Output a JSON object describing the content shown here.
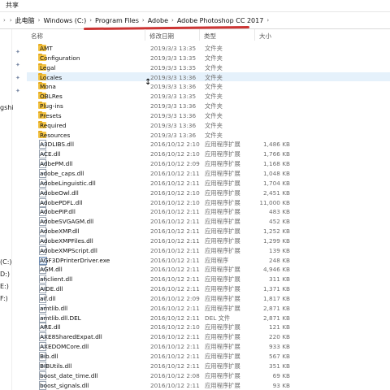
{
  "tab": {
    "label": "共享"
  },
  "address": {
    "crumbs": [
      "此电脑",
      "Windows (C:)",
      "Program Files",
      "Adobe",
      "Adobe Photoshop CC 2017"
    ],
    "chevron": "›"
  },
  "nav": {
    "fragments": [
      {
        "text": "gshi"
      },
      {
        "text": "(C:)"
      },
      {
        "text": "D:)"
      },
      {
        "text": "E:)"
      },
      {
        "text": "F:)"
      }
    ]
  },
  "columns": {
    "name": "名称",
    "date": "修改日期",
    "type": "类型",
    "size": "大小"
  },
  "files": [
    {
      "name": "AMT",
      "date": "2019/3/3 13:35",
      "type": "文件夹",
      "size": "",
      "kind": "folder"
    },
    {
      "name": "Configuration",
      "date": "2019/3/3 13:35",
      "type": "文件夹",
      "size": "",
      "kind": "folder"
    },
    {
      "name": "Legal",
      "date": "2019/3/3 13:35",
      "type": "文件夹",
      "size": "",
      "kind": "folder"
    },
    {
      "name": "Locales",
      "date": "2019/3/3 13:36",
      "type": "文件夹",
      "size": "",
      "kind": "folder",
      "selected": true
    },
    {
      "name": "Mona",
      "date": "2019/3/3 13:36",
      "type": "文件夹",
      "size": "",
      "kind": "folder"
    },
    {
      "name": "OBLRes",
      "date": "2019/3/3 13:35",
      "type": "文件夹",
      "size": "",
      "kind": "folder"
    },
    {
      "name": "Plug-ins",
      "date": "2019/3/3 13:36",
      "type": "文件夹",
      "size": "",
      "kind": "folder"
    },
    {
      "name": "Presets",
      "date": "2019/3/3 13:36",
      "type": "文件夹",
      "size": "",
      "kind": "folder"
    },
    {
      "name": "Required",
      "date": "2019/3/3 13:36",
      "type": "文件夹",
      "size": "",
      "kind": "folder"
    },
    {
      "name": "Resources",
      "date": "2019/3/3 13:36",
      "type": "文件夹",
      "size": "",
      "kind": "folder"
    },
    {
      "name": "A3DLIBS.dll",
      "date": "2016/10/12 2:10",
      "type": "应用程序扩展",
      "size": "1,486 KB",
      "kind": "dll"
    },
    {
      "name": "ACE.dll",
      "date": "2016/10/12 2:10",
      "type": "应用程序扩展",
      "size": "1,766 KB",
      "kind": "dll"
    },
    {
      "name": "AdbePM.dll",
      "date": "2016/10/12 2:09",
      "type": "应用程序扩展",
      "size": "1,168 KB",
      "kind": "dll"
    },
    {
      "name": "adobe_caps.dll",
      "date": "2016/10/12 2:11",
      "type": "应用程序扩展",
      "size": "1,048 KB",
      "kind": "dll"
    },
    {
      "name": "AdobeLinguistic.dll",
      "date": "2016/10/12 2:11",
      "type": "应用程序扩展",
      "size": "1,704 KB",
      "kind": "dll"
    },
    {
      "name": "AdobeOwl.dll",
      "date": "2016/10/12 2:10",
      "type": "应用程序扩展",
      "size": "2,451 KB",
      "kind": "dll"
    },
    {
      "name": "AdobePDFL.dll",
      "date": "2016/10/12 2:10",
      "type": "应用程序扩展",
      "size": "11,000 KB",
      "kind": "dll"
    },
    {
      "name": "AdobePIP.dll",
      "date": "2016/10/12 2:11",
      "type": "应用程序扩展",
      "size": "483 KB",
      "kind": "dll"
    },
    {
      "name": "AdobeSVGAGM.dll",
      "date": "2016/10/12 2:11",
      "type": "应用程序扩展",
      "size": "452 KB",
      "kind": "dll"
    },
    {
      "name": "AdobeXMP.dll",
      "date": "2016/10/12 2:11",
      "type": "应用程序扩展",
      "size": "1,252 KB",
      "kind": "dll"
    },
    {
      "name": "AdobeXMPFiles.dll",
      "date": "2016/10/12 2:11",
      "type": "应用程序扩展",
      "size": "1,299 KB",
      "kind": "dll"
    },
    {
      "name": "AdobeXMPScript.dll",
      "date": "2016/10/12 2:11",
      "type": "应用程序扩展",
      "size": "139 KB",
      "kind": "dll"
    },
    {
      "name": "AGF3DPrinterDriver.exe",
      "date": "2016/10/12 2:11",
      "type": "应用程序",
      "size": "248 KB",
      "kind": "exe"
    },
    {
      "name": "AGM.dll",
      "date": "2016/10/12 2:11",
      "type": "应用程序扩展",
      "size": "4,946 KB",
      "kind": "dll"
    },
    {
      "name": "ahclient.dll",
      "date": "2016/10/12 2:11",
      "type": "应用程序扩展",
      "size": "311 KB",
      "kind": "dll"
    },
    {
      "name": "AIDE.dll",
      "date": "2016/10/12 2:11",
      "type": "应用程序扩展",
      "size": "1,371 KB",
      "kind": "dll"
    },
    {
      "name": "aif.dll",
      "date": "2016/10/12 2:09",
      "type": "应用程序扩展",
      "size": "1,817 KB",
      "kind": "dll"
    },
    {
      "name": "amtlib.dll",
      "date": "2016/10/12 2:11",
      "type": "应用程序扩展",
      "size": "2,871 KB",
      "kind": "dll"
    },
    {
      "name": "amtlib.dll.DEL",
      "date": "2016/10/12 2:11",
      "type": "DEL 文件",
      "size": "2,871 KB",
      "kind": "dll"
    },
    {
      "name": "ARE.dll",
      "date": "2016/10/12 2:10",
      "type": "应用程序扩展",
      "size": "121 KB",
      "kind": "dll"
    },
    {
      "name": "AXE8SharedExpat.dll",
      "date": "2016/10/12 2:11",
      "type": "应用程序扩展",
      "size": "220 KB",
      "kind": "dll"
    },
    {
      "name": "AXEDOMCore.dll",
      "date": "2016/10/12 2:11",
      "type": "应用程序扩展",
      "size": "933 KB",
      "kind": "dll"
    },
    {
      "name": "Bib.dll",
      "date": "2016/10/12 2:11",
      "type": "应用程序扩展",
      "size": "567 KB",
      "kind": "dll"
    },
    {
      "name": "BIBUtils.dll",
      "date": "2016/10/12 2:11",
      "type": "应用程序扩展",
      "size": "351 KB",
      "kind": "dll"
    },
    {
      "name": "boost_date_time.dll",
      "date": "2016/10/12 2:08",
      "type": "应用程序扩展",
      "size": "69 KB",
      "kind": "dll"
    },
    {
      "name": "boost_signals.dll",
      "date": "2016/10/12 2:11",
      "type": "应用程序扩展",
      "size": "93 KB",
      "kind": "dll"
    }
  ]
}
